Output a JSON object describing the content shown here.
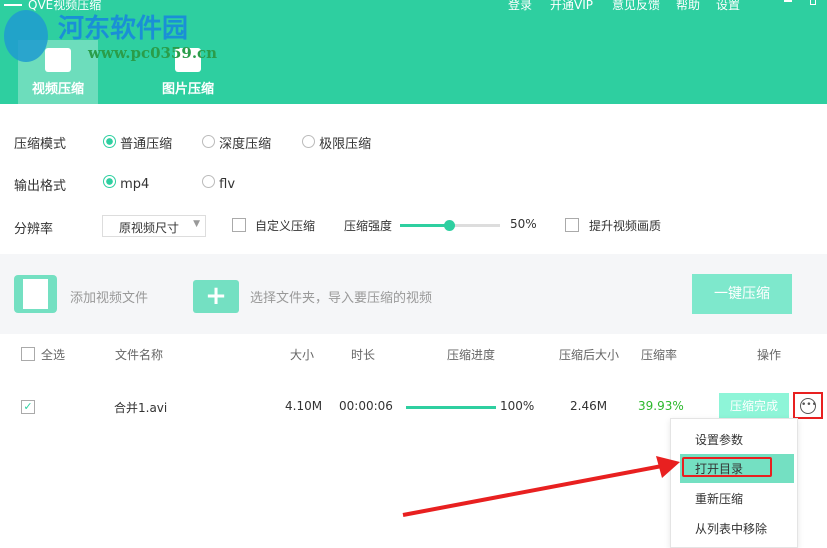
{
  "app": {
    "title": "QVE视频压缩",
    "top_menu": [
      "登录",
      "开通VIP",
      "意见反馈",
      "帮助",
      "设置"
    ]
  },
  "watermark": {
    "name": "河东软件园",
    "url": "www.pc0359.cn"
  },
  "tabs": [
    {
      "label": "视频压缩",
      "active": true,
      "icon": "video-icon"
    },
    {
      "label": "图片压缩",
      "active": false,
      "icon": "image-icon"
    }
  ],
  "settings": {
    "mode": {
      "label": "压缩模式",
      "options": [
        "普通压缩",
        "深度压缩",
        "极限压缩"
      ],
      "selected": "普通压缩"
    },
    "format": {
      "label": "输出格式",
      "options": [
        "mp4",
        "flv"
      ],
      "selected": "mp4"
    },
    "resolution": {
      "label": "分辨率",
      "value": "原视频尺寸",
      "custom_label": "自定义压缩",
      "custom_checked": false,
      "strength_label": "压缩强度",
      "strength": "50%",
      "strength_value": 50,
      "enhance_label": "提升视频画质",
      "enhance_checked": false
    }
  },
  "toolbar": {
    "add_video": "添加视频文件",
    "add_folder": "选择文件夹，导入要压缩的视频",
    "compress_all": "一键压缩"
  },
  "table": {
    "headers": {
      "select_all": "全选",
      "name": "文件名称",
      "size": "大小",
      "duration": "时长",
      "progress": "压缩进度",
      "new_size": "压缩后大小",
      "ratio": "压缩率",
      "action": "操作"
    },
    "rows": [
      {
        "checked": true,
        "name": "合并1.avi",
        "size": "4.10M",
        "duration": "00:00:06",
        "progress": "100%",
        "progress_value": 100,
        "new_size": "2.46M",
        "ratio": "39.93%",
        "status": "压缩完成"
      }
    ]
  },
  "context_menu": {
    "items": [
      "设置参数",
      "打开目录",
      "重新压缩",
      "从列表中移除"
    ],
    "highlighted": "打开目录"
  },
  "colors": {
    "brand": "#2ecfa0",
    "ratio": "#2cb82c",
    "annotation": "#e82020"
  }
}
